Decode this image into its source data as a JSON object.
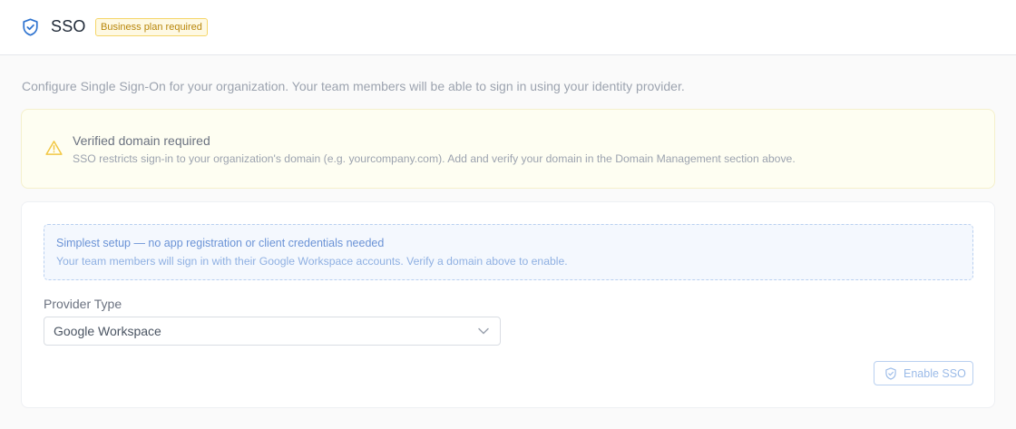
{
  "header": {
    "title": "SSO",
    "badge": "Business plan required",
    "icon": "shield-check-icon"
  },
  "description": "Configure Single Sign-On for your organization. Your team members will be able to sign in using your identity provider.",
  "warning": {
    "icon": "warning-triangle-icon",
    "title": "Verified domain required",
    "text": "SSO restricts sign-in to your organization's domain (e.g. yourcompany.com). Add and verify your domain in the Domain Management section above."
  },
  "info": {
    "title": "Simplest setup — no app registration or client credentials needed",
    "text": "Your team members will sign in with their Google Workspace accounts. Verify a domain above to enable."
  },
  "provider": {
    "label": "Provider Type",
    "selected": "Google Workspace"
  },
  "enable_button": {
    "label": "Enable SSO",
    "icon": "shield-check-icon"
  },
  "colors": {
    "accent": "#2f74d0",
    "badge_text": "#b8860b",
    "warning_icon": "#f2c744"
  }
}
